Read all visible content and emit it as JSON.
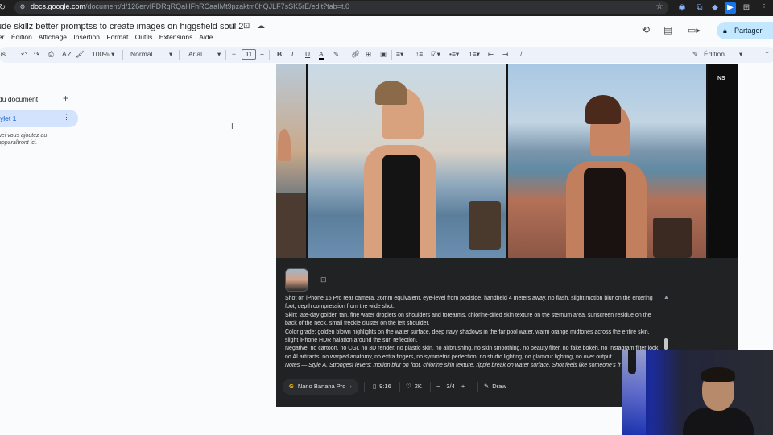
{
  "browser": {
    "url_host": "docs.google.com",
    "url_rest": "/document/d/126ervIFDRqRQaHFhRCaaIMt9pzaktm0hQJLF7sSK5rE/edit?tab=t.0"
  },
  "doc": {
    "title": "ude skillz better promptss to create images on higgsfield soul 2",
    "menu": [
      "ier",
      "Édition",
      "Affichage",
      "Insertion",
      "Format",
      "Outils",
      "Extensions",
      "Aide"
    ],
    "share_label": "Partager"
  },
  "toolbar": {
    "search_label": "us",
    "zoom": "100%",
    "style": "Normal",
    "font": "Arial",
    "font_size": "11",
    "mode": "Édition"
  },
  "outline": {
    "title": "du document",
    "tab_label": "ylet 1",
    "hint": "uei vous ajoutez au apparaîtront ici."
  },
  "media": {
    "badge": "NS",
    "prompt_lines": [
      "Shot on iPhone 15 Pro rear camera, 26mm equivalent, eye-level from poolside, handheld 4 meters away, no flash, slight motion blur on the entering foot, depth compression from the wide shot.",
      "Skin: late-day golden tan, fine water droplets on shoulders and forearms, chlorine-dried skin texture on the sternum area, sunscreen residue on the back of the neck, small freckle cluster on the left shoulder.",
      "Color grade: golden blown highlights on the water surface, deep navy shadows in the far pool water, warm orange midtones across the entire skin, slight iPhone HDR halation around the sun reflection.",
      "Negative: no cartoon, no CGI, no 3D render, no plastic skin, no airbrushing, no skin smoothing, no beauty filter, no fake bokeh, no Instagram filter look, no AI artifacts, no warped anatomy, no extra fingers, no symmetric perfection, no studio lighting, no glamour lighting, no over output."
    ],
    "notes_line": "Notes — Style A. Strongest levers: motion blur on foot, chlorine skin texture, ripple break on water surface. Shot feels like someone's fr",
    "model": "Nano Banana Pro",
    "aspect": "9:16",
    "resolution": "2K",
    "count": "3/4",
    "draw_label": "Draw"
  }
}
